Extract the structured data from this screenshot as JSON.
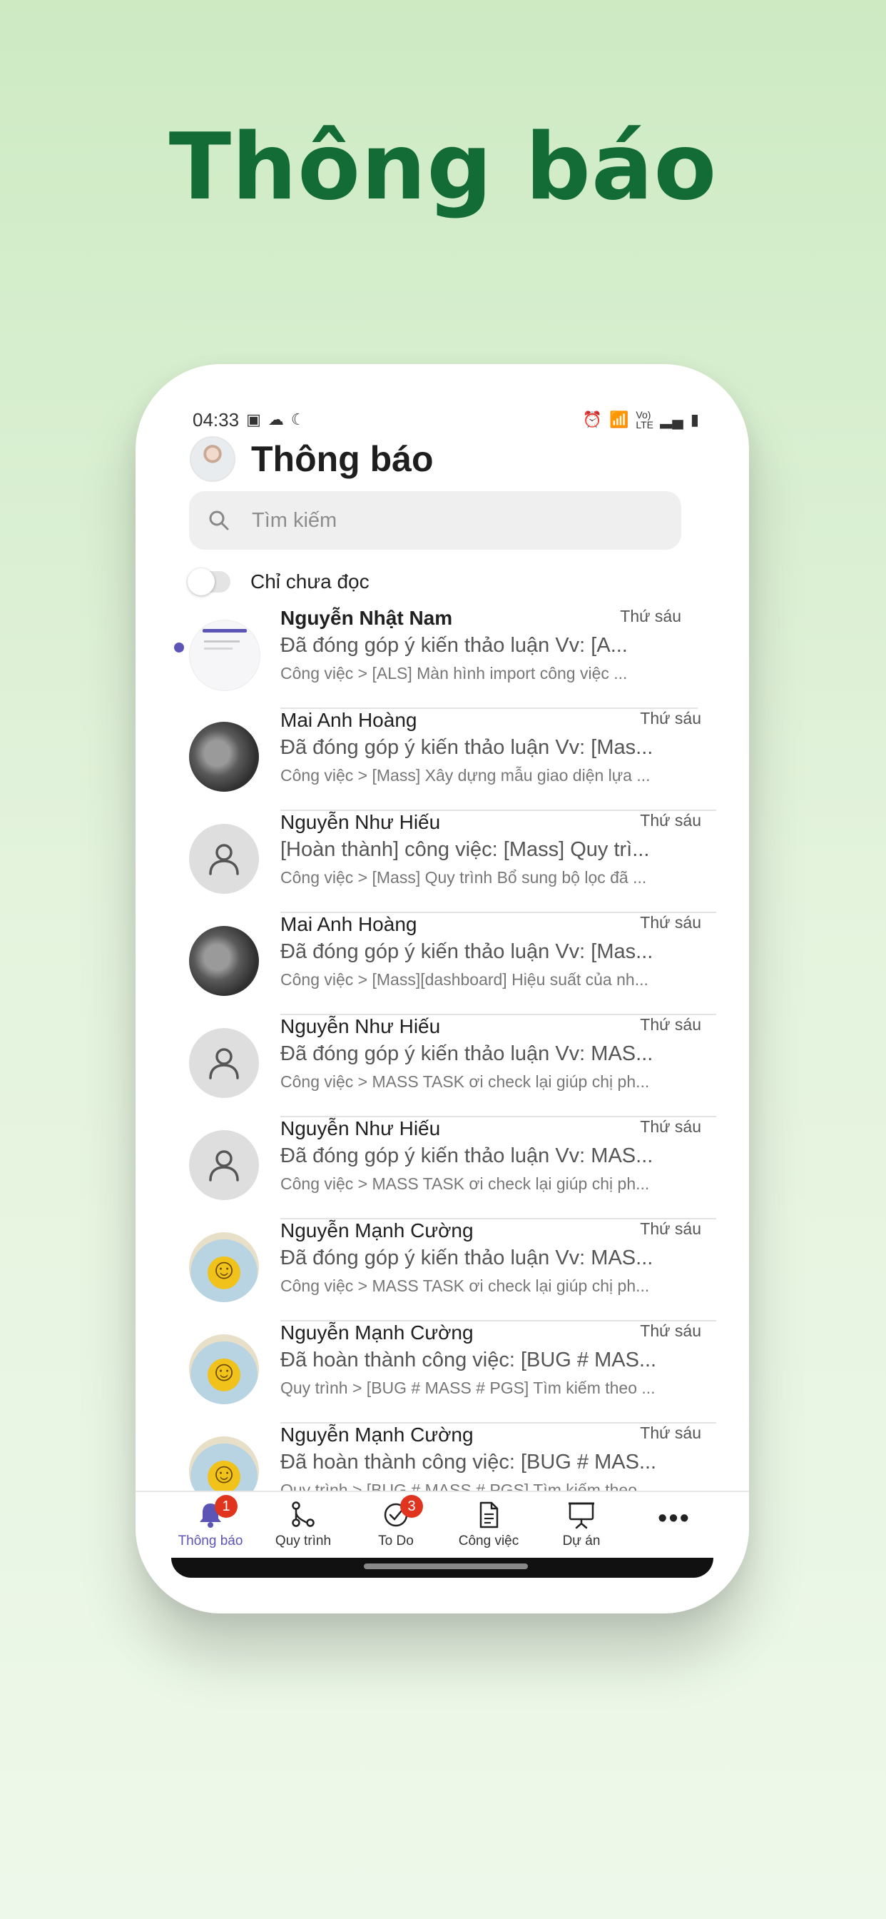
{
  "hero": {
    "title": "Thông báo"
  },
  "status_bar": {
    "time": "04:33",
    "network": "Vo) LTE"
  },
  "header": {
    "title": "Thông báo"
  },
  "search": {
    "placeholder": "Tìm kiếm"
  },
  "filter": {
    "label": "Chỉ chưa đọc",
    "enabled": false
  },
  "notifications": [
    {
      "name": "Nguyễn Nhật Nam",
      "message": "Đã đóng góp ý kiến thảo luận Vv: [A...",
      "crumb": "Công việc > [ALS] Màn hình import công việc ...",
      "time": "Thứ sáu",
      "unread": true,
      "avatar": "doc-thumb"
    },
    {
      "name": "Mai Anh Hoàng",
      "message": "Đã đóng góp ý kiến thảo luận Vv: [Mas...",
      "crumb": "Công việc > [Mass] Xây dựng mẫu giao diện lựa ...",
      "time": "Thứ sáu",
      "avatar": "photo"
    },
    {
      "name": "Nguyễn Như Hiếu",
      "message": "[Hoàn thành] công việc: [Mass] Quy trì...",
      "crumb": "Công việc > [Mass] Quy trình Bổ sung bộ lọc đã ...",
      "time": "Thứ sáu",
      "avatar": "default"
    },
    {
      "name": "Mai Anh Hoàng",
      "message": "Đã đóng góp ý kiến thảo luận Vv: [Mas...",
      "crumb": "Công việc > [Mass][dashboard] Hiệu suất của nh...",
      "time": "Thứ sáu",
      "avatar": "photo"
    },
    {
      "name": "Nguyễn Như Hiếu",
      "message": "Đã đóng góp ý kiến thảo luận Vv: MAS...",
      "crumb": "Công việc > MASS TASK ơi check lại giúp chị ph...",
      "time": "Thứ sáu",
      "avatar": "default"
    },
    {
      "name": "Nguyễn Như Hiếu",
      "message": "Đã đóng góp ý kiến thảo luận Vv: MAS...",
      "crumb": "Công việc > MASS TASK ơi check lại giúp chị ph...",
      "time": "Thứ sáu",
      "avatar": "default"
    },
    {
      "name": "Nguyễn Mạnh Cường",
      "message": "Đã đóng góp ý kiến thảo luận Vv: MAS...",
      "crumb": "Công việc > MASS TASK ơi check lại giúp chị ph...",
      "time": "Thứ sáu",
      "avatar": "smiley"
    },
    {
      "name": "Nguyễn Mạnh Cường",
      "message": "Đã hoàn thành công việc: [BUG # MAS...",
      "crumb": "Quy trình > [BUG # MASS # PGS] Tìm kiếm theo ...",
      "time": "Thứ sáu",
      "avatar": "smiley"
    },
    {
      "name": "Nguyễn Mạnh Cường",
      "message": "Đã hoàn thành công việc: [BUG # MAS...",
      "crumb": "Quy trình > [BUG # MASS # PGS] Tìm kiếm theo ...",
      "time": "Thứ sáu",
      "avatar": "smiley"
    }
  ],
  "tabs": [
    {
      "label": "Thông báo",
      "icon": "bell-icon",
      "badge": "1",
      "active": true
    },
    {
      "label": "Quy trình",
      "icon": "workflow-icon"
    },
    {
      "label": "To Do",
      "icon": "check-circle-icon",
      "badge": "3"
    },
    {
      "label": "Công việc",
      "icon": "document-icon"
    },
    {
      "label": "Dự án",
      "icon": "presentation-icon"
    },
    {
      "label": "",
      "icon": "more-icon"
    }
  ],
  "colors": {
    "hero": "#136b35",
    "accent": "#5c55b5",
    "badge": "#e1341f"
  }
}
